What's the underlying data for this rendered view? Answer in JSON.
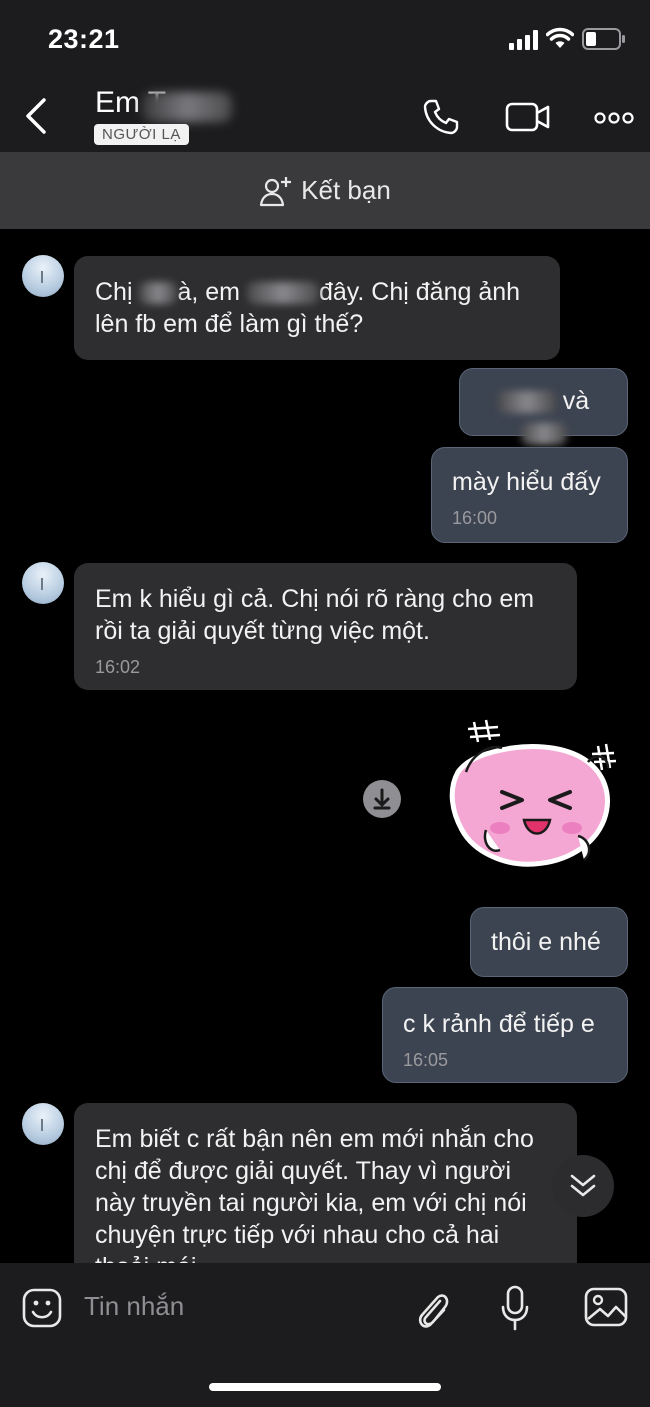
{
  "status_bar": {
    "time": "23:21"
  },
  "header": {
    "contact_name": "Em T",
    "badge": "NGƯỜI LẠ"
  },
  "add_friend": {
    "label": "Kết bạn"
  },
  "messages": [
    {
      "side": "in",
      "parts": [
        "Chị ",
        "à, em ",
        "đây. Chị đăng ảnh lên fb em để làm gì thế?"
      ]
    },
    {
      "side": "out",
      "text": "và"
    },
    {
      "side": "out",
      "text": "mày hiểu đấy",
      "time": "16:00"
    },
    {
      "side": "in",
      "text": "Em k hiểu gì cả. Chị nói rõ ràng cho em rồi ta giải quyết từng việc một.",
      "time": "16:02"
    },
    {
      "side": "out",
      "text": "thôi e nhé"
    },
    {
      "side": "out",
      "text": "c k rảnh để tiếp e",
      "time": "16:05"
    },
    {
      "side": "in",
      "text": "Em biết c rất bận nên em mới nhắn cho chị để được giải quyết. Thay vì người này truyền tai người kia, em với chị nói chuyện trực tiếp với nhau cho cả hai thoải mái"
    }
  ],
  "input": {
    "placeholder": "Tin nhắn"
  },
  "colors": {
    "background": "#000000",
    "bar": "#1c1c1e",
    "incoming_bubble": "#2e2e30",
    "outgoing_bubble": "#3d4451",
    "sticker_pink": "#f4a7d3"
  }
}
